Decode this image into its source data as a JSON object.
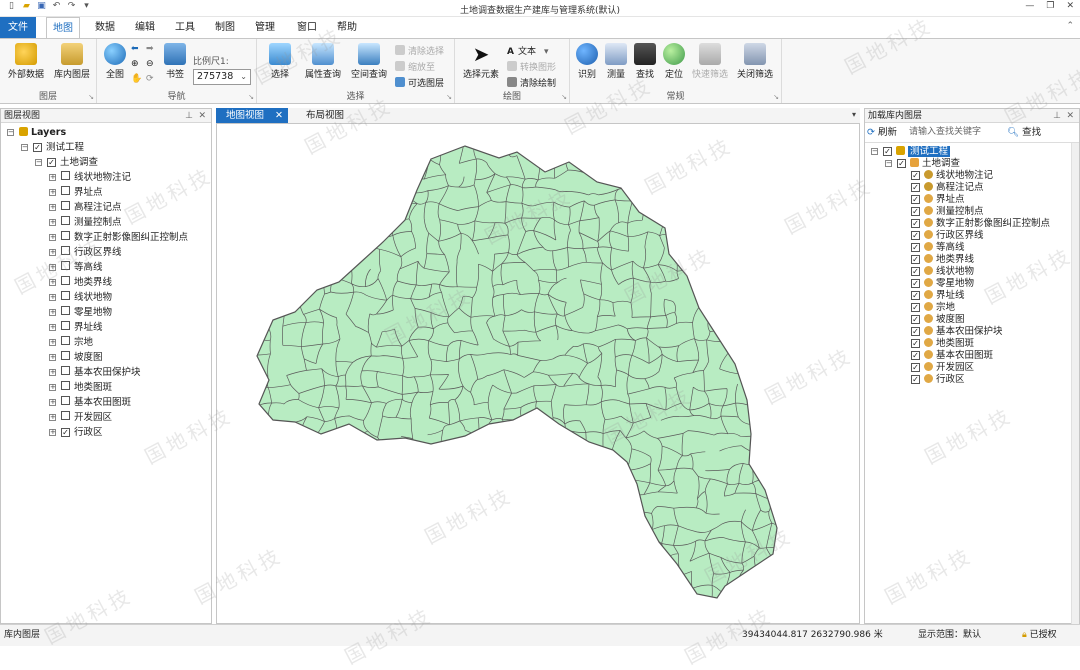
{
  "app": {
    "title": "土地调查数据生产建库与管理系统(默认)"
  },
  "menu": {
    "file": "文件",
    "tabs": [
      "地图",
      "数据",
      "编辑",
      "工具",
      "制图",
      "管理",
      "窗口",
      "帮助"
    ],
    "active_tab": "地图"
  },
  "ribbon": {
    "layer_group": {
      "label": "图层",
      "external_data": "外部数据",
      "lib_layer": "库内图层"
    },
    "nav_group": {
      "label": "导航",
      "full_extent": "全图",
      "bookmark": "书签",
      "scale_label": "比例尺1:",
      "scale_value": "275738"
    },
    "select_group": {
      "label": "选择",
      "select": "选择",
      "attr_query": "属性查询",
      "spatial_query": "空间查询",
      "clear_select": "清除选择",
      "zoom_to": "缩放至",
      "selectable_layers": "可选图层"
    },
    "draw_group": {
      "label": "绘图",
      "select_element": "选择元素",
      "text": "文本",
      "convert_shape": "转换图形",
      "clear_draw": "清除绘制"
    },
    "common_group": {
      "label": "常规",
      "identify": "识别",
      "measure": "测量",
      "find": "查找",
      "locate": "定位",
      "quick_filter": "快速筛选",
      "close_filter": "关闭筛选"
    }
  },
  "layers_panel": {
    "title": "图层视图",
    "root": "Layers",
    "project": "测试工程",
    "group": "土地调查",
    "items": [
      {
        "label": "线状地物注记",
        "checked": false
      },
      {
        "label": "界址点",
        "checked": false
      },
      {
        "label": "高程注记点",
        "checked": false
      },
      {
        "label": "测量控制点",
        "checked": false
      },
      {
        "label": "数字正射影像图纠正控制点",
        "checked": false
      },
      {
        "label": "行政区界线",
        "checked": false
      },
      {
        "label": "等高线",
        "checked": false
      },
      {
        "label": "地类界线",
        "checked": false
      },
      {
        "label": "线状地物",
        "checked": false
      },
      {
        "label": "零星地物",
        "checked": false
      },
      {
        "label": "界址线",
        "checked": false
      },
      {
        "label": "宗地",
        "checked": false
      },
      {
        "label": "坡度图",
        "checked": false
      },
      {
        "label": "基本农田保护块",
        "checked": false
      },
      {
        "label": "地类图斑",
        "checked": false
      },
      {
        "label": "基本农田图斑",
        "checked": false
      },
      {
        "label": "开发园区",
        "checked": false
      },
      {
        "label": "行政区",
        "checked": true
      }
    ]
  },
  "doc_tabs": {
    "map_view": "地图视图",
    "layout_view": "布局视图"
  },
  "db_panel": {
    "title": "加载库内图层",
    "refresh": "刷新",
    "search_placeholder": "请输入查找关键字",
    "search_button": "查找",
    "project": "测试工程",
    "group": "土地调查",
    "items": [
      "线状地物注记",
      "高程注记点",
      "界址点",
      "测量控制点",
      "数字正射影像图纠正控制点",
      "行政区界线",
      "等高线",
      "地类界线",
      "线状地物",
      "零星地物",
      "界址线",
      "宗地",
      "坡度图",
      "基本农田保护块",
      "地类图斑",
      "基本农田图斑",
      "开发园区",
      "行政区"
    ]
  },
  "status": {
    "left": "库内图层",
    "coords": "39434044.817   2632790.986 米",
    "extent": "显示范围：默认",
    "license": "已授权"
  },
  "watermark": "国地科技",
  "colors": {
    "accent": "#1f6fc1",
    "map_fill": "#b8ecc2",
    "map_stroke": "#555555"
  }
}
